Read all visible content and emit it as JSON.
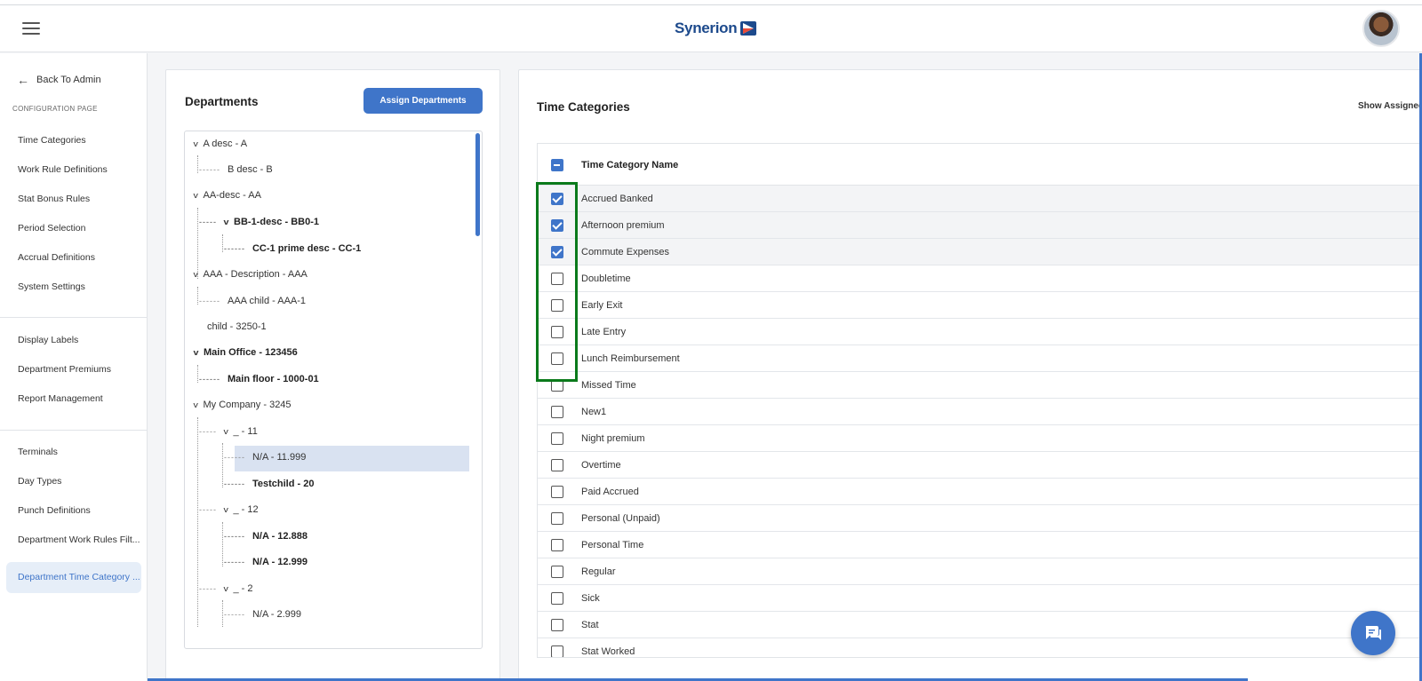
{
  "header": {
    "logo_text": "Synerion",
    "menu_icon": "hamburger-icon",
    "avatar_icon": "user-avatar"
  },
  "sidebar": {
    "back_label": "Back To Admin",
    "section_label": "CONFIGURATION PAGE",
    "items": [
      {
        "label": "Time Categories"
      },
      {
        "label": "Work Rule Definitions"
      },
      {
        "label": "Stat Bonus Rules"
      },
      {
        "label": "Period Selection"
      },
      {
        "label": "Accrual Definitions"
      },
      {
        "label": "System Settings"
      },
      {
        "label": "Display Labels"
      },
      {
        "label": "Department Premiums"
      },
      {
        "label": "Report Management"
      },
      {
        "label": "Terminals"
      },
      {
        "label": "Day Types"
      },
      {
        "label": "Punch Definitions"
      },
      {
        "label": "Department Work Rules Filt..."
      },
      {
        "label": "Department Time Category ..."
      }
    ],
    "active_item": "Department Time Category ..."
  },
  "departments": {
    "title": "Departments",
    "assign_button": "Assign Departments",
    "tree": [
      {
        "label": "A desc - A",
        "bold": false
      },
      {
        "label": "B desc - B",
        "bold": false
      },
      {
        "label": "AA-desc - AA",
        "bold": false
      },
      {
        "label": "BB-1-desc - BB0-1",
        "bold": true
      },
      {
        "label": "CC-1 prime desc - CC-1",
        "bold": true
      },
      {
        "label": "AAA - Description - AAA",
        "bold": false
      },
      {
        "label": "AAA child - AAA-1",
        "bold": false
      },
      {
        "label": "child - 3250-1",
        "bold": false
      },
      {
        "label": "Main Office - 123456",
        "bold": true
      },
      {
        "label": "Main floor - 1000-01",
        "bold": true
      },
      {
        "label": "My Company - 3245",
        "bold": false
      },
      {
        "label": "_ - 11",
        "bold": false
      },
      {
        "label": "N/A - 11.999",
        "bold": false,
        "selected": true
      },
      {
        "label": "Testchild - 20",
        "bold": true
      },
      {
        "label": "_ - 12",
        "bold": false
      },
      {
        "label": "N/A - 12.888",
        "bold": true
      },
      {
        "label": "N/A - 12.999",
        "bold": true
      },
      {
        "label": "_ - 2",
        "bold": false
      },
      {
        "label": "N/A - 2.999",
        "bold": false
      }
    ]
  },
  "time_categories": {
    "title": "Time Categories",
    "show_assigned": "Show Assigned",
    "column_header": "Time Category Name",
    "rows": [
      {
        "name": "Accrued Banked",
        "checked": true
      },
      {
        "name": "Afternoon premium",
        "checked": true
      },
      {
        "name": "Commute Expenses",
        "checked": true
      },
      {
        "name": "Doubletime",
        "checked": false
      },
      {
        "name": "Early Exit",
        "checked": false
      },
      {
        "name": "Late Entry",
        "checked": false
      },
      {
        "name": "Lunch Reimbursement",
        "checked": false
      },
      {
        "name": "Missed Time",
        "checked": false
      },
      {
        "name": "New1",
        "checked": false
      },
      {
        "name": "Night premium",
        "checked": false
      },
      {
        "name": "Overtime",
        "checked": false
      },
      {
        "name": "Paid Accrued",
        "checked": false
      },
      {
        "name": "Personal (Unpaid)",
        "checked": false
      },
      {
        "name": "Personal Time",
        "checked": false
      },
      {
        "name": "Regular",
        "checked": false
      },
      {
        "name": "Sick",
        "checked": false
      },
      {
        "name": "Stat",
        "checked": false
      },
      {
        "name": "Stat Worked",
        "checked": false
      }
    ]
  },
  "colors": {
    "accent": "#3f75c9",
    "highlight_box": "#0b7a1b",
    "selected_row": "#d9e2f1"
  },
  "chat_icon": "chat-bubble-icon"
}
